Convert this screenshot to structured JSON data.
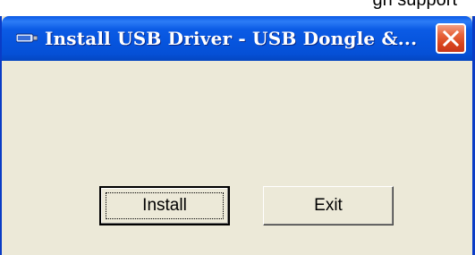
{
  "top_banner": {
    "text": "gn support"
  },
  "window": {
    "title": "Install USB Driver - USB Dongle &...",
    "icon": "usb-device-icon",
    "close_icon": "close-icon",
    "colors": {
      "titlebar": "#0a58e6",
      "body": "#ece9d8",
      "close": "#d9451c"
    }
  },
  "buttons": {
    "install_label": "Install",
    "exit_label": "Exit"
  }
}
